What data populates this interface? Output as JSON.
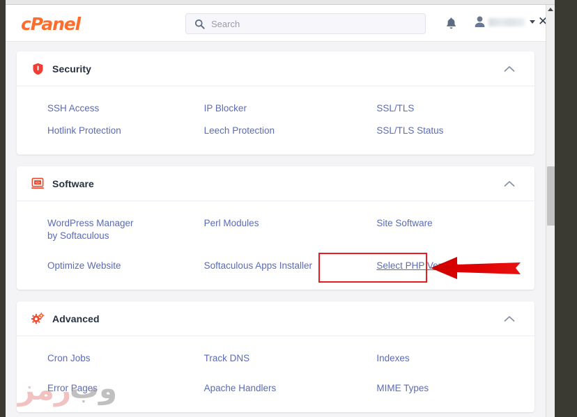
{
  "window": {
    "scrollbar": {
      "up_arrow": "scroll-up-arrow",
      "thumb": "scroll-thumb"
    }
  },
  "header": {
    "logo_text": "cPanel",
    "search": {
      "placeholder": "Search",
      "value": "",
      "icon": "search-icon"
    },
    "notifications_icon": "bell-icon",
    "account": {
      "avatar_icon": "user-avatar-icon",
      "username": "",
      "dropdown_icon": "chevron-down-icon",
      "close_label": "✕"
    }
  },
  "sections": [
    {
      "id": "security",
      "title": "Security",
      "icon": "shield-icon",
      "collapse_icon": "chevron-up-icon",
      "links": [
        "SSH Access",
        "IP Blocker",
        "SSL/TLS",
        "Hotlink Protection",
        "Leech Protection",
        "SSL/TLS Status"
      ]
    },
    {
      "id": "software",
      "title": "Software",
      "icon": "code-window-icon",
      "collapse_icon": "chevron-up-icon",
      "links": [
        "WordPress Manager by Softaculous",
        "Perl Modules",
        "Site Software",
        "Optimize Website",
        "Softaculous Apps Installer",
        "Select PHP Version"
      ]
    },
    {
      "id": "advanced",
      "title": "Advanced",
      "icon": "gears-icon",
      "collapse_icon": "chevron-up-icon",
      "links": [
        "Cron Jobs",
        "Track DNS",
        "Indexes",
        "Error Pages",
        "Apache Handlers",
        "MIME Types"
      ]
    }
  ],
  "annotation": {
    "highlighted_link": "Select PHP Version",
    "box_color": "#e81c1c",
    "arrow_color": "#dd0000",
    "arrow_direction": "left"
  },
  "watermark": {
    "text_gray": "وب",
    "text_red": "رمز",
    "gray_color": "#9a9a9a",
    "red_color": "#e79d9d"
  },
  "colors": {
    "brand_orange": "#ff6c2c",
    "link_blue": "#5b6bb5",
    "title_dark": "#26303f",
    "page_bg": "#f4f4f6"
  }
}
